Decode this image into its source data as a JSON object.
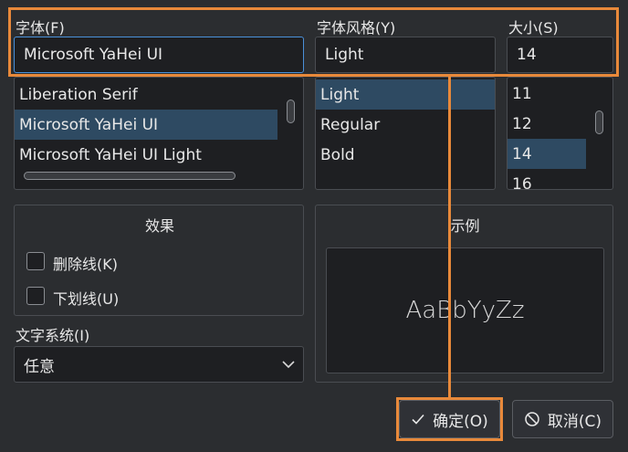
{
  "font_family": {
    "label": "字体(F)",
    "value": "Microsoft YaHei UI",
    "items": [
      {
        "label": "Liberation Serif",
        "selected": false
      },
      {
        "label": "Microsoft YaHei UI",
        "selected": true
      },
      {
        "label": "Microsoft YaHei UI Light",
        "selected": false
      }
    ]
  },
  "font_style": {
    "label": "字体风格(Y)",
    "value": "Light",
    "items": [
      {
        "label": "Light",
        "selected": true
      },
      {
        "label": "Regular",
        "selected": false
      },
      {
        "label": "Bold",
        "selected": false
      }
    ]
  },
  "font_size": {
    "label": "大小(S)",
    "value": "14",
    "items": [
      {
        "label": "11",
        "selected": false
      },
      {
        "label": "12",
        "selected": false
      },
      {
        "label": "14",
        "selected": true
      },
      {
        "label": "16",
        "selected": false
      }
    ]
  },
  "effects": {
    "title": "效果",
    "strikeout_label": "删除线(K)",
    "strikeout_checked": false,
    "underline_label": "下划线(U)",
    "underline_checked": false
  },
  "writing_system": {
    "label": "文字系统(I)",
    "value": "任意"
  },
  "sample": {
    "title": "示例",
    "text": "AaBbYyZz"
  },
  "buttons": {
    "ok": "确定(O)",
    "cancel": "取消(C)"
  },
  "colors": {
    "background": "#2b2d30",
    "selection": "#2e4a62",
    "highlight": "#e8893a",
    "focus": "#4a90d9"
  },
  "icons": {
    "ok": "check-icon",
    "cancel": "prohibit-icon",
    "combo": "chevron-down-icon"
  }
}
